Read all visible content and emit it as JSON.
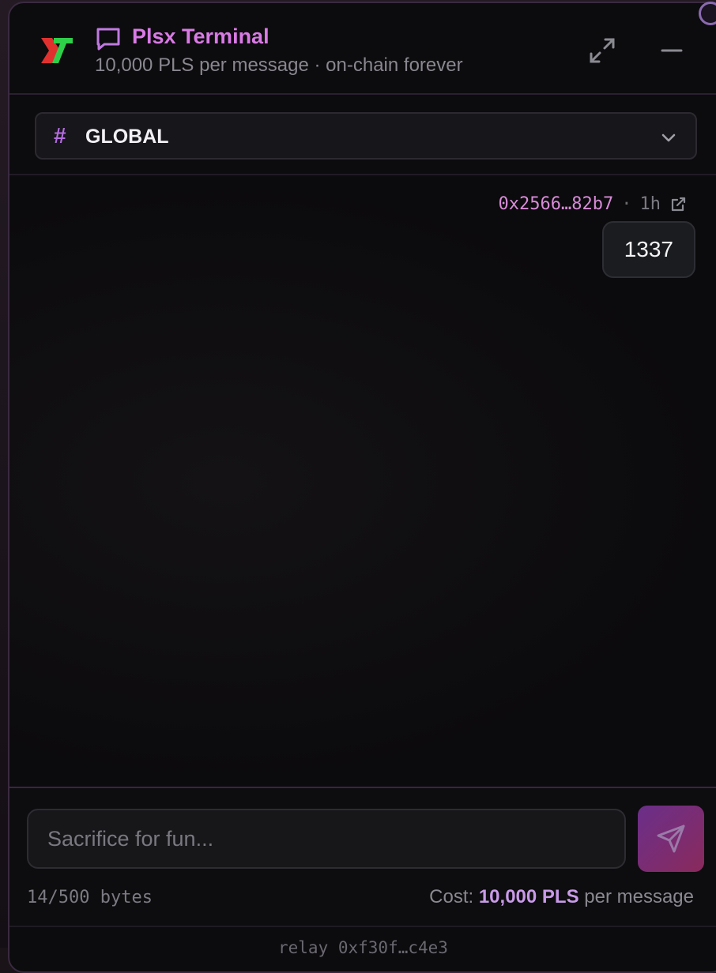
{
  "header": {
    "title": "Plsx Terminal",
    "subtitle": "10,000 PLS per message · on-chain forever",
    "logo_icon": "plsx-logo-icon",
    "chat_icon": "chat-bubble-icon",
    "expand_icon": "expand-arrows-icon",
    "minimize_icon": "minimize-icon",
    "title_color": "#d97ae6"
  },
  "channel": {
    "hash": "#",
    "name": "GLOBAL",
    "chevron_icon": "chevron-down-icon"
  },
  "messages": [
    {
      "address": "0x2566…82b7",
      "separator": "·",
      "time": "1h",
      "link_icon": "external-link-icon",
      "text": "1337"
    }
  ],
  "composer": {
    "placeholder": "Sacrifice for fun...",
    "value": "",
    "send_icon": "send-icon",
    "bytes": "14/500 bytes",
    "cost_label": "Cost:",
    "cost_value": "10,000 PLS",
    "cost_suffix": "per message",
    "accent_color": "#c89ae8"
  },
  "footer": {
    "relay": "relay 0xf30f…c4e3"
  }
}
